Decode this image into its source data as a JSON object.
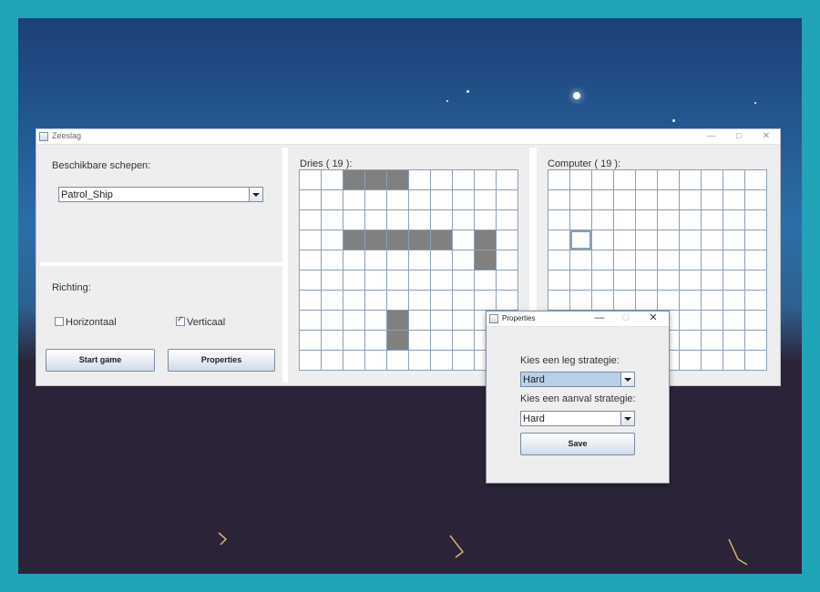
{
  "main_window": {
    "title": "Zeeslag",
    "controls": {
      "minimize": "—",
      "maximize": "□",
      "close": "✕"
    },
    "ships_label": "Beschikbare schepen:",
    "ship_select": "Patrol_Ship",
    "direction_label": "Richting:",
    "horizontal_label": "Horizontaal",
    "horizontal_checked": false,
    "vertical_label": "Verticaal",
    "vertical_checked": true,
    "start_button": "Start game",
    "properties_button": "Properties"
  },
  "player_board": {
    "label": "Dries ( 19 ):",
    "ships": [
      [
        0,
        2
      ],
      [
        0,
        3
      ],
      [
        0,
        4
      ],
      [
        3,
        2
      ],
      [
        3,
        3
      ],
      [
        3,
        4
      ],
      [
        3,
        5
      ],
      [
        3,
        6
      ],
      [
        3,
        8
      ],
      [
        4,
        8
      ],
      [
        7,
        4
      ],
      [
        8,
        4
      ]
    ]
  },
  "computer_board": {
    "label": "Computer ( 19 ):",
    "selected": [
      3,
      1
    ]
  },
  "properties_dialog": {
    "title": "Properties",
    "controls": {
      "minimize": "—",
      "maximize": "□",
      "close": "✕"
    },
    "place_strategy_label": "Kies een leg strategie:",
    "place_strategy_value": "Hard",
    "attack_strategy_label": "Kies een aanval strategie:",
    "attack_strategy_value": "Hard",
    "save_button": "Save"
  }
}
